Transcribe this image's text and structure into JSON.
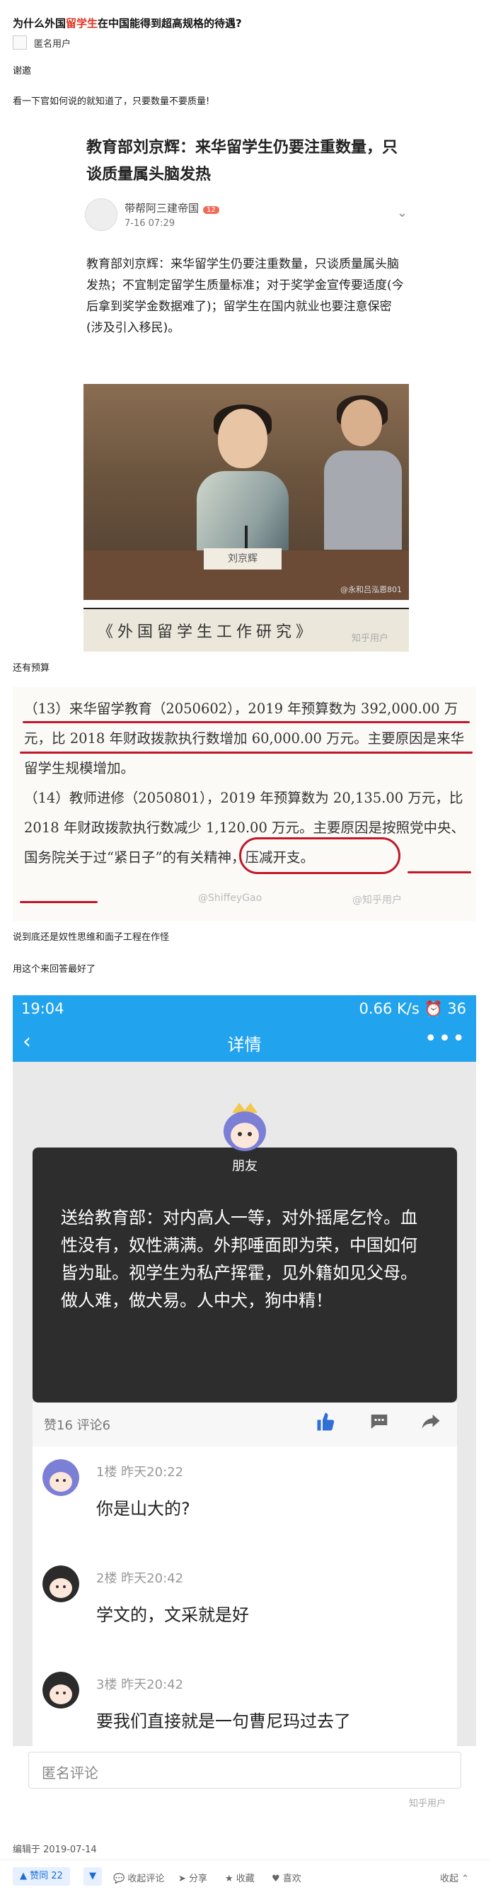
{
  "question": {
    "title_pre": "为什么外国",
    "title_hl": "留学生",
    "title_post": "在中国能得到超高规格的待遇?"
  },
  "author": {
    "name": "匿名用户"
  },
  "answer": {
    "p1": "谢邀",
    "p2": "看一下官如何说的就知道了，只要数量不要质量!",
    "p3": "还有预算",
    "p4": "说到底还是奴性思维和面子工程在作怪",
    "p5": "用这个来回答最好了"
  },
  "article": {
    "title": "教育部刘京辉：来华留学生仍要注重数量，只谈质量属头脑发热",
    "user": "带帮阿三建帝国",
    "badge": "12",
    "date": "7-16 07:29",
    "more": "⌄",
    "body": "教育部刘京辉：来华留学生仍要注重数量，只谈质量属头脑发热；不宜制定留学生质量标准；对于奖学金宣传要适度(今后拿到奖学金数据难了)；留学生在国内就业也要注意保密(涉及引入移民)。",
    "nameplate": "刘京辉",
    "photo_wm": "@永和吕泓恩801",
    "strip": "《外国留学生工作研究》",
    "wm": "知乎用户"
  },
  "doc": {
    "para1": "（13）来华留学教育（2050602），2019 年预算数为 392,000.00 万元，比 2018 年财政拨款执行数增加 60,000.00 万元。主要原因是来华留学生规模增加。",
    "para2": "（14）教师进修（2050801），2019 年预算数为 20,135.00 万元，比 2018 年财政拨款执行数减少 1,120.00 万元。主要原因是按照党中央、国务院关于过“紧日子”的有关精神，压减开支。",
    "wm1": "@ShiffeyGao",
    "wm2": "@知乎用户"
  },
  "phone": {
    "time": "19:04",
    "status_right": "0.66 K/s  ⏰ 36",
    "back": "‹",
    "title": "详情",
    "dots": "•••",
    "card_name": "朋友",
    "card_text": "送给教育部：对内高人一等，对外摇尾乞怜。血性没有，奴性满满。外邦唾面即为荣，中国如何皆为耻。视学生为私产挥霍，见外籍如见父母。做人难，做犬易。人中犬，狗中精！",
    "counts": "赞16  评论6",
    "comments": [
      {
        "meta": "1楼   昨天20:22",
        "text": "你是山大的?"
      },
      {
        "meta": "2楼   昨天20:42",
        "text": "学文的，文采就是好"
      },
      {
        "meta": "3楼   昨天20:42",
        "text": "要我们直接就是一句曹尼玛过去了"
      }
    ],
    "input_placeholder": "匿名评论",
    "wm": "知乎用户"
  },
  "footer": {
    "edited": "编辑于 2019-07-14",
    "vote": "▲ 赞同 22",
    "down": "▼",
    "comment": "💬 收起评论",
    "share": "➤ 分享",
    "collect": "★ 收藏",
    "like": "♥ 喜欢",
    "collapse": "收起 ⌃"
  }
}
